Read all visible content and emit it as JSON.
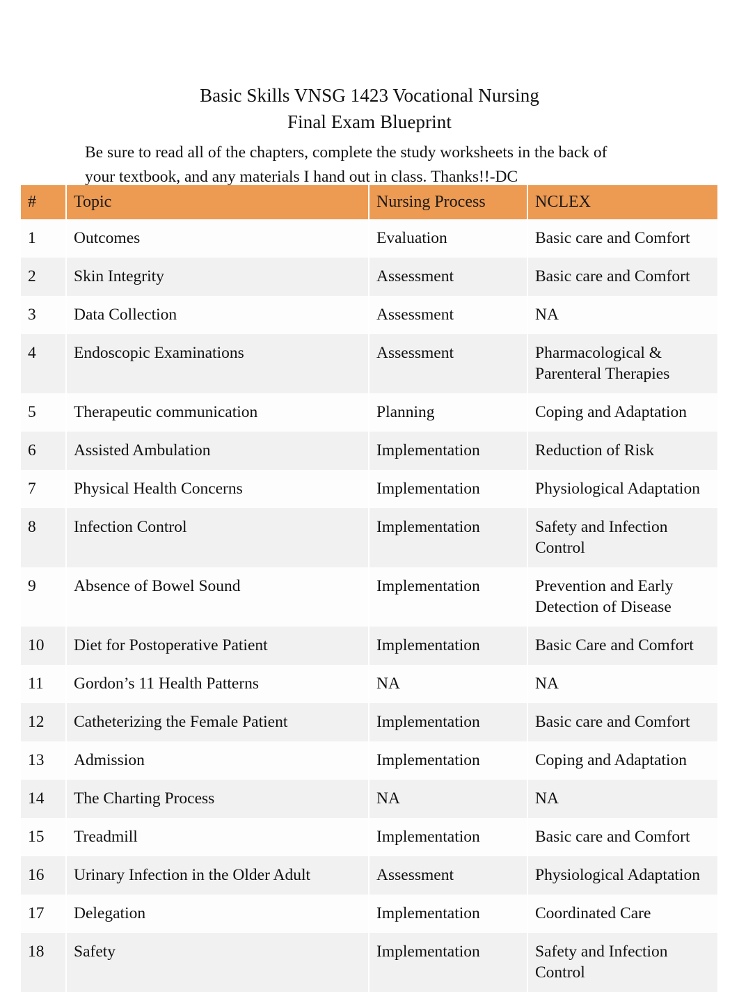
{
  "document": {
    "title_lines": [
      "Basic Skills VNSG 1423 Vocational Nursing",
      "Final Exam Blueprint"
    ],
    "intro_lines": [
      "Be sure to read all of the chapters, complete the study worksheets in the back of",
      "your textbook, and any materials I hand out in class. Thanks!!-DC"
    ]
  },
  "colors": {
    "header_orange": "#ED9A52",
    "row_alt": "#f1f1f1",
    "row_base": "#fdfdfd",
    "text": "#111111"
  },
  "table": {
    "columns": [
      "#",
      "Topic",
      "Nursing Process",
      "NCLEX"
    ],
    "rows": [
      {
        "num": "1",
        "topic": "Outcomes",
        "process": "Evaluation",
        "nclex": "Basic care and Comfort"
      },
      {
        "num": "2",
        "topic": "Skin Integrity",
        "process": "Assessment",
        "nclex": "Basic care and Comfort"
      },
      {
        "num": "3",
        "topic": "Data Collection",
        "process": "Assessment",
        "nclex": "NA"
      },
      {
        "num": "4",
        "topic": "Endoscopic Examinations",
        "process": "Assessment",
        "nclex": "Pharmacological & Parenteral Therapies"
      },
      {
        "num": "5",
        "topic": "Therapeutic communication",
        "process": "Planning",
        "nclex": "Coping and Adaptation"
      },
      {
        "num": "6",
        "topic": "Assisted Ambulation",
        "process": "Implementation",
        "nclex": "Reduction of Risk"
      },
      {
        "num": "7",
        "topic": "Physical Health Concerns",
        "process": "Implementation",
        "nclex": "Physiological Adaptation"
      },
      {
        "num": "8",
        "topic": "Infection Control",
        "process": "Implementation",
        "nclex": "Safety and Infection Control"
      },
      {
        "num": "9",
        "topic": "Absence of Bowel Sound",
        "process": "Implementation",
        "nclex": "Prevention and Early Detection of Disease"
      },
      {
        "num": "10",
        "topic": "Diet for Postoperative Patient",
        "process": "Implementation",
        "nclex": "Basic Care and Comfort"
      },
      {
        "num": "11",
        "topic": "Gordon’s 11 Health Patterns",
        "process": "NA",
        "nclex": "NA"
      },
      {
        "num": "12",
        "topic": "Catheterizing the Female Patient",
        "process": "Implementation",
        "nclex": "Basic care and Comfort"
      },
      {
        "num": "13",
        "topic": "Admission",
        "process": "Implementation",
        "nclex": "Coping and Adaptation"
      },
      {
        "num": "14",
        "topic": "The Charting Process",
        "process": "NA",
        "nclex": "NA"
      },
      {
        "num": "15",
        "topic": "Treadmill",
        "process": "Implementation",
        "nclex": "Basic care and Comfort"
      },
      {
        "num": "16",
        "topic": "Urinary Infection in the Older Adult",
        "process": "Assessment",
        "nclex": "Physiological Adaptation"
      },
      {
        "num": "17",
        "topic": "Delegation",
        "process": "Implementation",
        "nclex": "Coordinated Care"
      },
      {
        "num": "18",
        "topic": "Safety",
        "process": "Implementation",
        "nclex": "Safety and Infection Control"
      }
    ]
  }
}
